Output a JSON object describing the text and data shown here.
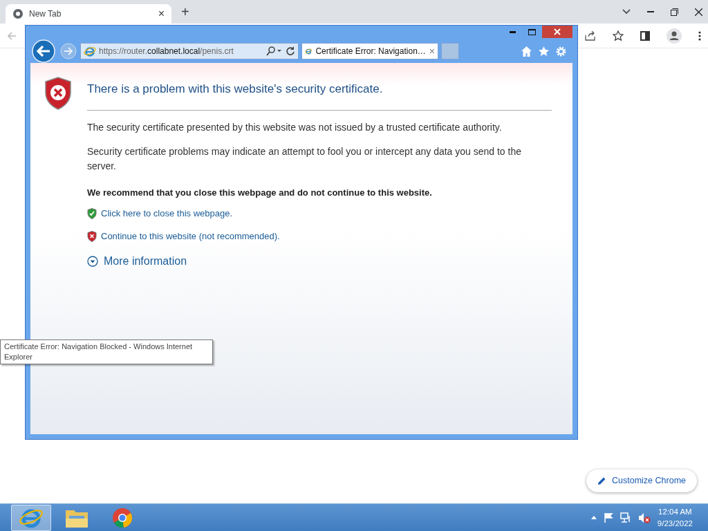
{
  "chrome": {
    "tab": {
      "title": "New Tab",
      "close": "×"
    },
    "new_tab": "+",
    "customize_button": "Customize Chrome"
  },
  "ie": {
    "address": "https://router.**collabnet.local**/penis.crt",
    "tab": {
      "title": "Certificate Error: Navigation…",
      "close": "×"
    },
    "heading": "There is a problem with this website's security certificate.",
    "paragraphs": [
      "The security certificate presented by this website was not issued by a trusted certificate authority.",
      "Security certificate problems may indicate an attempt to fool you or intercept any data you send to the server."
    ],
    "recommendation": "We recommend that you close this webpage and do not continue to this website.",
    "links": [
      {
        "kind": "safe",
        "text": "Click here to close this webpage."
      },
      {
        "kind": "unsafe",
        "text": "Continue to this website (not recommended)."
      }
    ],
    "more_info": {
      "text": "More information",
      "expanded": false
    }
  },
  "tooltip": "Certificate Error: Navigation Blocked - Windows Internet Explorer",
  "taskbar": {
    "items": [
      {
        "kind": "ie",
        "selected": true
      },
      {
        "kind": "folder",
        "selected": false
      },
      {
        "kind": "chrome",
        "selected": false
      }
    ],
    "time": "12:04 AM",
    "date": "9/23/2022"
  }
}
